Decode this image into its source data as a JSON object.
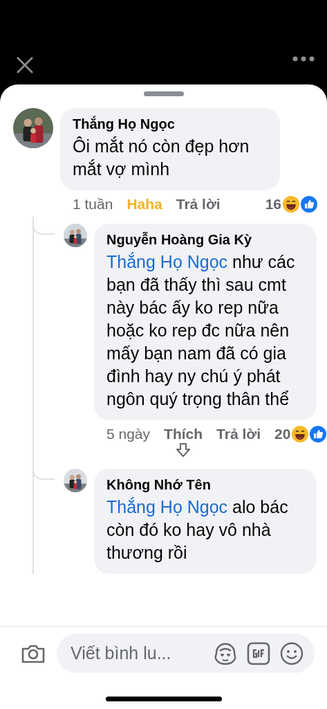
{
  "comments": [
    {
      "name": "Thắng Họ Ngọc",
      "text": "Ôi mắt nó còn đẹp hơn mắt vợ mình",
      "time": "1 tuần",
      "like_label": "Haha",
      "reacted": true,
      "reply_label": "Trả lời",
      "reaction_count": "16",
      "replies": [
        {
          "name": "Nguyễn Hoàng Gia Kỳ",
          "mention": "Thắng Họ Ngọc",
          "text": "như các bạn đã thấy thì sau cmt này bác ấy ko rep nữa hoặc ko rep đc nữa nên mấy bạn nam đã có gia đình hay ny chú ý phát ngôn quý trọng thân thể",
          "time": "5 ngày",
          "like_label": "Thích",
          "reacted": false,
          "reply_label": "Trả lời",
          "reaction_count": "20",
          "arrow_hint": true
        },
        {
          "name": "Không Nhớ Tên",
          "mention": "Thắng Họ Ngọc",
          "text": "alo bác còn đó ko hay vô nhà thương rồi"
        }
      ]
    }
  ],
  "composer": {
    "placeholder": "Viết bình lu..."
  }
}
